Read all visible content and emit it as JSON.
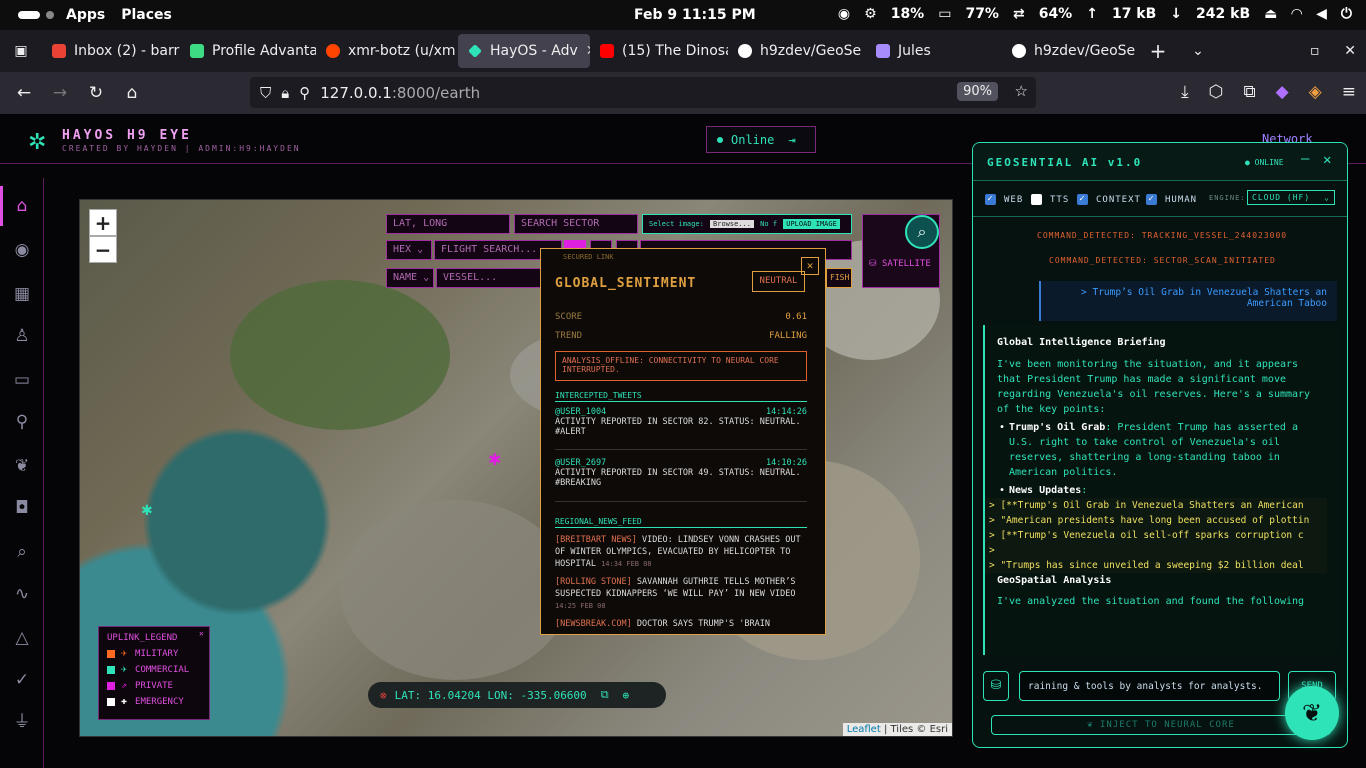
{
  "system": {
    "apps": "Apps",
    "places": "Places",
    "clock": "Feb 9  11:15 PM",
    "cpu": "18%",
    "mem": "77%",
    "swap": "64%",
    "up": "17 kB",
    "down": "242 kB"
  },
  "tabs": [
    {
      "label": "Inbox (2) - barr",
      "color": "#ea4335"
    },
    {
      "label": "Profile Advanta",
      "color": "#3ddc84"
    },
    {
      "label": "xmr-botz (u/xm",
      "color": "#ff4500"
    },
    {
      "label": "HayOS - Adv",
      "color": "#2fe3b8"
    },
    {
      "label": "(15) The Dinosa",
      "color": "#ff0000"
    },
    {
      "label": "h9zdev/GeoSe",
      "color": "#ffffff"
    },
    {
      "label": "Jules",
      "color": "#a78bfa"
    },
    {
      "label": "h9zdev/GeoSe",
      "color": "#ffffff"
    }
  ],
  "url": {
    "host": "127.0.0.1",
    "rest": ":8000/earth",
    "zoom": "90%"
  },
  "app": {
    "title": "HAYOS H9 EYE",
    "subtitle": "CREATED BY HAYDEN | ADMIN:H9:HAYDEN",
    "status": "Online",
    "network": "Network"
  },
  "map": {
    "lat_placeholder": "LAT, LONG",
    "sector_placeholder": "SEARCH SECTOR",
    "image_label": "Select image:",
    "browse": "Browse...",
    "no_file": "No f",
    "upload": "UPLOAD IMAGE",
    "hex": "HEX",
    "flight_placeholder": "FLIGHT SEARCH...",
    "name": "NAME",
    "vessel_placeholder": "VESSEL...",
    "fish": "FISH",
    "satellite": "SATELLITE",
    "coords": "LAT: 16.04204 LON: -335.06600",
    "attribution_link": "Leaflet",
    "attribution_rest": " | Tiles © Esri",
    "zoom_in": "+",
    "zoom_out": "−"
  },
  "legend": {
    "title": "UPLINK_LEGEND",
    "items": [
      {
        "label": "MILITARY",
        "color": "#ff6a20"
      },
      {
        "label": "COMMERCIAL",
        "color": "#2fe3b8"
      },
      {
        "label": "PRIVATE",
        "color": "#e020e0"
      },
      {
        "label": "EMERGENCY",
        "color": "#ffffff"
      }
    ]
  },
  "sentiment": {
    "secured": "SECURED LINK",
    "title": "GLOBAL_SENTIMENT",
    "badge": "NEUTRAL",
    "score_label": "SCORE",
    "score": "0.61",
    "trend_label": "TREND",
    "trend": "FALLING",
    "alert": "ANALYSIS_OFFLINE: CONNECTIVITY TO NEURAL CORE INTERRUPTED.",
    "tweets_title": "INTERCEPTED_TWEETS",
    "tweets": [
      {
        "user": "@USER_1004",
        "time": "14:14:26",
        "text": "ACTIVITY REPORTED IN SECTOR 82. STATUS: NEUTRAL. #ALERT"
      },
      {
        "user": "@USER_2697",
        "time": "14:10:26",
        "text": "ACTIVITY REPORTED IN SECTOR 49. STATUS: NEUTRAL. #BREAKING"
      }
    ],
    "news_title": "REGIONAL_NEWS_FEED",
    "news": [
      {
        "source": "[BREITBART NEWS]",
        "text": " VIDEO: LINDSEY VONN CRASHES OUT OF WINTER OLYMPICS, EVACUATED BY HELICOPTER TO HOSPITAL",
        "time": "14:34 FEB 08"
      },
      {
        "source": "[ROLLING STONE]",
        "text": " SAVANNAH GUTHRIE TELLS MOTHER’S SUSPECTED KIDNAPPERS ‘WE WILL PAY’ IN NEW VIDEO",
        "time": "14:25 FEB 08"
      },
      {
        "source": "[NEWSBREAK.COM]",
        "text": " DOCTOR SAYS TRUMP'S 'BRAIN",
        "time": ""
      }
    ]
  },
  "ai": {
    "title": "GEOSENTIAL AI v1.0",
    "online": "● ONLINE",
    "opts": {
      "web": "WEB",
      "tts": "TTS",
      "context": "CONTEXT",
      "human": "HUMAN",
      "engine_label": "ENGINE:",
      "engine": "CLOUD (HF)"
    },
    "cmd1": "COMMAND_DETECTED: TRACKING_VESSEL_244023000",
    "cmd2": "COMMAND_DETECTED: SECTOR_SCAN_INITIATED",
    "user_msg": "> Trump’s Oil Grab in Venezuela Shatters an American Taboo",
    "brief_title": "Global Intelligence Briefing",
    "brief_intro": "I've been monitoring the situation, and it appears that President Trump has made a significant move regarding Venezuela's oil reserves. Here's a summary of the key points:",
    "bullet1_title": "Trump's Oil Grab",
    "bullet1_text": ": President Trump has asserted a U.S. right to take control of Venezuela's oil reserves, shattering a long-standing taboo in American politics.",
    "bullet2_title": "News Updates",
    "bullet2_text": ":",
    "quotes": [
      "> [**Trump's Oil Grab in Venezuela Shatters an American",
      "> \"American presidents have long been accused of plottin",
      "> [**Trump's Venezuela oil sell-off sparks corruption c",
      ">",
      "> \"Trumps has since unveiled a sweeping $2 billion deal"
    ],
    "geo_title": "GeoSpatial Analysis",
    "geo_text": "I've analyzed the situation and found the following",
    "input": "raining & tools by analysts for analysts.",
    "send": "SEND",
    "inject": "INJECT TO NEURAL CORE"
  }
}
